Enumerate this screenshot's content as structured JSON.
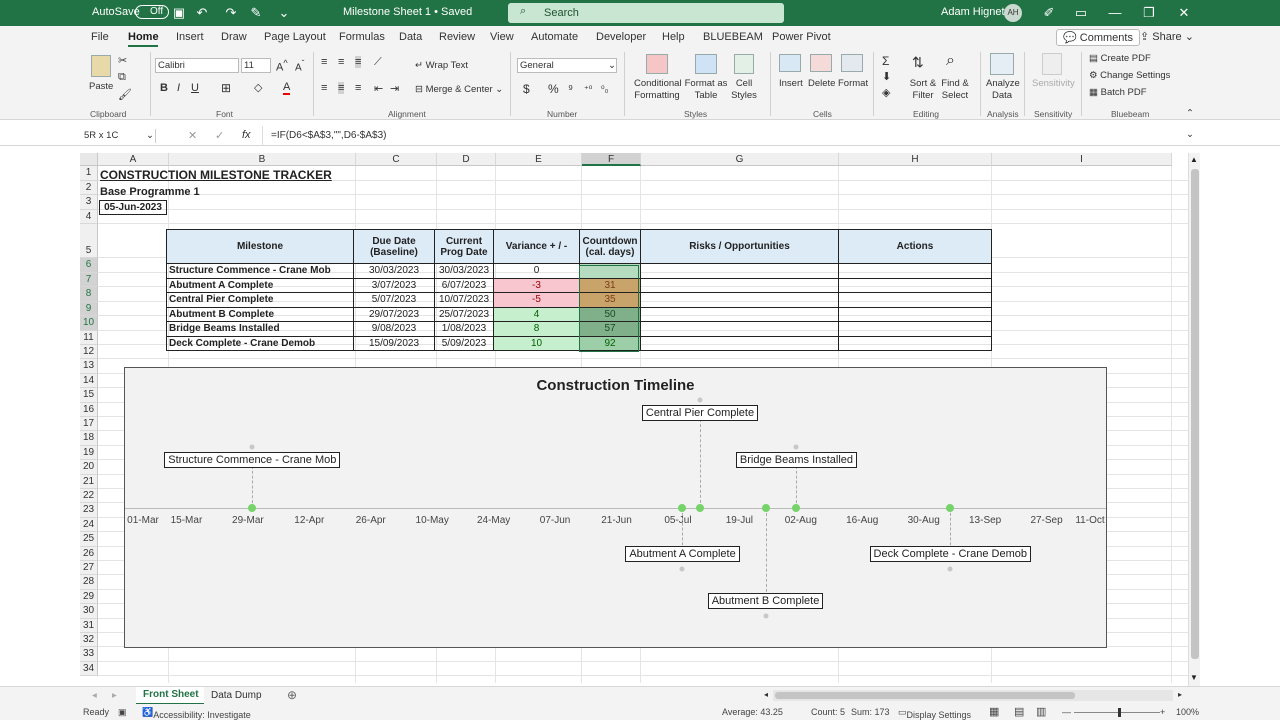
{
  "titlebar": {
    "autosave": "AutoSave",
    "autosave_state": "Off",
    "doc_title": "Milestone Sheet 1 • Saved",
    "search_placeholder": "Search",
    "user": "Adam Hignett",
    "initials": "AH"
  },
  "menu": [
    "File",
    "Home",
    "Insert",
    "Draw",
    "Page Layout",
    "Formulas",
    "Data",
    "Review",
    "View",
    "Automate",
    "Developer",
    "Help",
    "BLUEBEAM",
    "Power Pivot"
  ],
  "menu_right": {
    "comments": "Comments",
    "share": "Share"
  },
  "ribbon": {
    "paste": "Paste",
    "clipboard": "Clipboard",
    "font_name": "Calibri",
    "font_size": "11",
    "font": "Font",
    "wrap": "Wrap Text",
    "merge": "Merge & Center",
    "alignment": "Alignment",
    "numfmt": "General",
    "number": "Number",
    "cond_fmt": "Conditional Formatting",
    "fmt_table": "Format as Table",
    "cell_styles": "Cell Styles",
    "styles": "Styles",
    "insert": "Insert",
    "delete": "Delete",
    "format": "Format",
    "cells": "Cells",
    "sort": "Sort & Filter",
    "find": "Find & Select",
    "editing": "Editing",
    "analyze": "Analyze Data",
    "analysis": "Analysis",
    "sensitivity": "Sensitivity",
    "create_pdf": "Create PDF",
    "change_settings": "Change Settings",
    "batch_pdf": "Batch PDF",
    "bluebeam": "Bluebeam"
  },
  "formula": {
    "namebox": "5R x 1C",
    "fx": "fx",
    "content": "=IF(D6<$A$3,\"\",D6-$A$3)"
  },
  "columns": [
    "A",
    "B",
    "C",
    "D",
    "E",
    "F",
    "G",
    "H",
    "I"
  ],
  "rows": [
    "1",
    "2",
    "3",
    "4",
    "5",
    "6",
    "7",
    "8",
    "9",
    "10",
    "11",
    "12",
    "13",
    "14",
    "15",
    "16",
    "17",
    "18",
    "19",
    "20",
    "21",
    "22",
    "23",
    "24",
    "25",
    "26",
    "27",
    "28",
    "29",
    "30",
    "31",
    "32",
    "33",
    "34"
  ],
  "sheet": {
    "title": "CONSTRUCTION MILESTONE TRACKER",
    "subtitle": "Base Programme 1",
    "date": "05-Jun-2023"
  },
  "table": {
    "headers": [
      "Milestone",
      "Due Date (Baseline)",
      "Current Prog Date",
      "Variance + / -",
      "Countdown (cal. days)",
      "Risks / Opportunities",
      "Actions"
    ],
    "rows": [
      {
        "milestone": "Structure Commence - Crane Mob",
        "due": "30/03/2023",
        "current": "30/03/2023",
        "variance": "0",
        "countdown": ""
      },
      {
        "milestone": "Abutment A Complete",
        "due": "3/07/2023",
        "current": "6/07/2023",
        "variance": "-3",
        "countdown": "31"
      },
      {
        "milestone": "Central Pier Complete",
        "due": "5/07/2023",
        "current": "10/07/2023",
        "variance": "-5",
        "countdown": "35"
      },
      {
        "milestone": "Abutment B Complete",
        "due": "29/07/2023",
        "current": "25/07/2023",
        "variance": "4",
        "countdown": "50"
      },
      {
        "milestone": "Bridge Beams Installed",
        "due": "9/08/2023",
        "current": "1/08/2023",
        "variance": "8",
        "countdown": "57"
      },
      {
        "milestone": "Deck Complete - Crane Demob",
        "due": "15/09/2023",
        "current": "5/09/2023",
        "variance": "10",
        "countdown": "92"
      }
    ]
  },
  "chart_data": {
    "type": "scatter",
    "title": "Construction Timeline",
    "x_ticks": [
      "01-Mar",
      "15-Mar",
      "29-Mar",
      "12-Apr",
      "26-Apr",
      "10-May",
      "24-May",
      "07-Jun",
      "21-Jun",
      "05-Jul",
      "19-Jul",
      "02-Aug",
      "16-Aug",
      "30-Aug",
      "13-Sep",
      "27-Sep",
      "11-Oct"
    ],
    "xlim": [
      "2023-03-01",
      "2023-10-11"
    ],
    "points": [
      {
        "label": "Structure Commence - Crane Mob",
        "date": "2023-03-30",
        "y": 2
      },
      {
        "label": "Abutment A Complete",
        "date": "2023-07-06",
        "y": -2
      },
      {
        "label": "Central Pier Complete",
        "date": "2023-07-10",
        "y": 4
      },
      {
        "label": "Abutment B Complete",
        "date": "2023-07-25",
        "y": -4
      },
      {
        "label": "Bridge Beams Installed",
        "date": "2023-08-01",
        "y": 2
      },
      {
        "label": "Deck Complete - Crane Demob",
        "date": "2023-09-05",
        "y": -2
      }
    ],
    "marker_color": "#75d36a"
  },
  "sheets": [
    "Front Sheet",
    "Data Dump"
  ],
  "status": {
    "ready": "Ready",
    "accessibility": "Accessibility: Investigate",
    "average": "Average: 43.25",
    "count": "Count: 5",
    "sum": "Sum: 173",
    "display": "Display Settings",
    "zoom": "100%"
  }
}
